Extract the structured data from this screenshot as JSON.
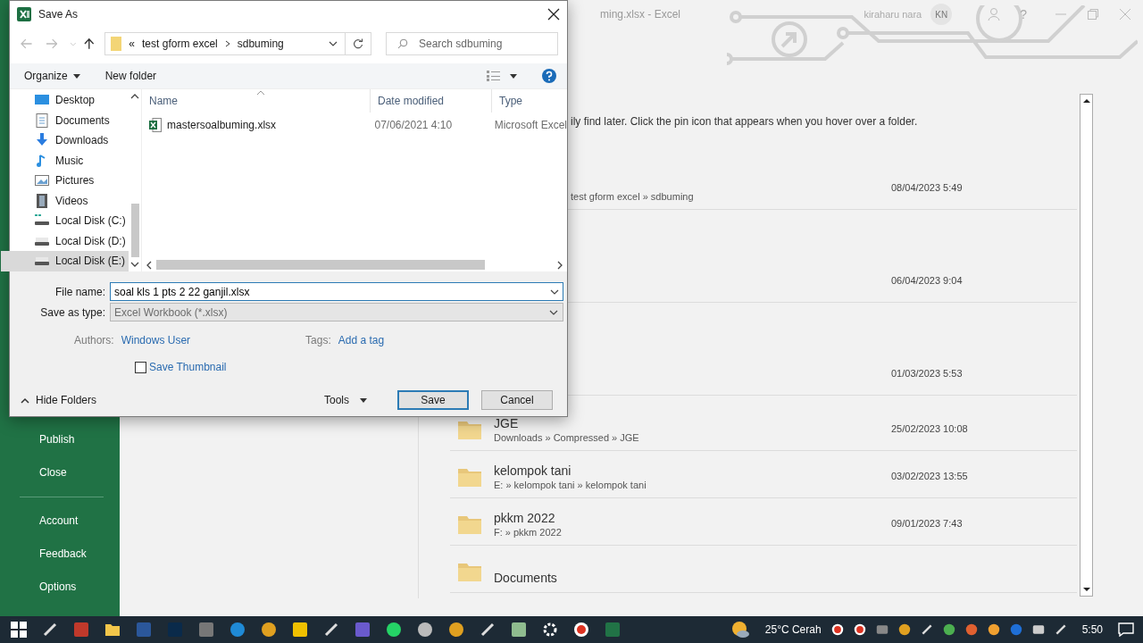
{
  "excel": {
    "title": "ming.xlsx  -  Excel",
    "user": "kiraharu nara",
    "initials": "KN",
    "help": "?",
    "nav_top": [
      "Publish",
      "Close"
    ],
    "nav_bottom": [
      "Account",
      "Feedback",
      "Options"
    ],
    "hint": "ily find later. Click the pin icon that appears when you hover over a folder.",
    "recent": [
      {
        "path": "test gform excel » sdbuming",
        "date": "08/04/2023 5:49"
      },
      {
        "date": "06/04/2023 9:04"
      },
      {
        "date": "01/03/2023 5:53"
      },
      {
        "name": "JGE",
        "path": "Downloads » Compressed » JGE",
        "date": "25/02/2023 10:08"
      },
      {
        "name": "kelompok tani",
        "path": "E: » kelompok tani » kelompok tani",
        "date": "03/02/2023 13:55"
      },
      {
        "name": "pkkm 2022",
        "path": "F: » pkkm 2022",
        "date": "09/01/2023 7:43"
      },
      {
        "name": "Documents"
      }
    ]
  },
  "dialog": {
    "title": "Save As",
    "overflow": "«",
    "address": [
      "test gform excel",
      "sdbuming"
    ],
    "search_placeholder": "Search sdbuming",
    "organize": "Organize",
    "new_folder": "New folder",
    "nav_items": [
      {
        "label": "Desktop",
        "kind": "desktop",
        "selected": false
      },
      {
        "label": "Documents",
        "kind": "documents",
        "selected": false
      },
      {
        "label": "Downloads",
        "kind": "downloads",
        "selected": false
      },
      {
        "label": "Music",
        "kind": "music",
        "selected": false
      },
      {
        "label": "Pictures",
        "kind": "pictures",
        "selected": false
      },
      {
        "label": "Videos",
        "kind": "videos",
        "selected": false
      },
      {
        "label": "Local Disk (C:)",
        "kind": "system-disk",
        "selected": false
      },
      {
        "label": "Local Disk (D:)",
        "kind": "disk",
        "selected": false
      },
      {
        "label": "Local Disk (E:)",
        "kind": "disk",
        "selected": true
      }
    ],
    "columns": [
      "Name",
      "Date modified",
      "Type"
    ],
    "files": [
      {
        "name": "mastersoalbuming.xlsx",
        "date": "07/06/2021 4:10",
        "type": "Microsoft Excel"
      }
    ],
    "file_name_label": "File name:",
    "file_name": "soal kls 1 pts 2 22 ganjil.xlsx",
    "type_label": "Save as type:",
    "type": "Excel Workbook (*.xlsx)",
    "authors_label": "Authors:",
    "authors": "Windows User",
    "tags_label": "Tags:",
    "tags": "Add a tag",
    "thumbnail": {
      "label": "Save Thumbnail",
      "checked": false
    },
    "hide_folders": "Hide Folders",
    "tools": "Tools",
    "save": "Save",
    "cancel": "Cancel"
  },
  "taskbar": {
    "weather": "25°C Cerah",
    "time": "5:50"
  }
}
